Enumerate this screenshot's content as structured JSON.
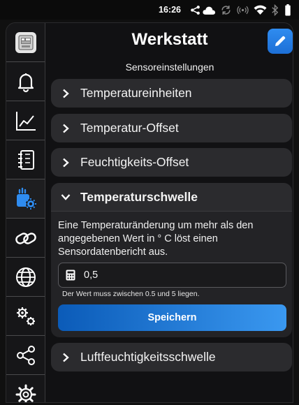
{
  "status_bar": {
    "time": "16:26",
    "icons": [
      "share-icon",
      "cloud-icon",
      "sync-icon",
      "hotspot-icon",
      "wifi-icon",
      "bluetooth-icon",
      "battery-icon"
    ]
  },
  "sidebar": {
    "items": [
      {
        "name": "device",
        "icon": "device-thumbnail-icon"
      },
      {
        "name": "notifications",
        "icon": "bell-icon"
      },
      {
        "name": "charts",
        "icon": "chart-line-icon"
      },
      {
        "name": "log",
        "icon": "log-list-icon"
      },
      {
        "name": "sensor-settings",
        "icon": "sensor-settings-icon",
        "active": true
      },
      {
        "name": "links",
        "icon": "link-icon"
      },
      {
        "name": "network",
        "icon": "globe-icon"
      },
      {
        "name": "advanced-settings",
        "icon": "gears-icon"
      },
      {
        "name": "share",
        "icon": "share-icon"
      },
      {
        "name": "settings",
        "icon": "gear-icon"
      }
    ],
    "accent": "#2f8cf0"
  },
  "header": {
    "title": "Werkstatt",
    "subtitle": "Sensoreinstellungen",
    "edit_icon": "pencil-icon"
  },
  "sections": [
    {
      "label": "Temperatureinheiten",
      "expanded": false
    },
    {
      "label": "Temperatur-Offset",
      "expanded": false
    },
    {
      "label": "Feuchtigkeits-Offset",
      "expanded": false
    },
    {
      "label": "Temperaturschwelle",
      "expanded": true
    },
    {
      "label": "Luftfeuchtigkeitsschwelle",
      "expanded": false
    }
  ],
  "threshold": {
    "description": "Eine Temperaturänderung um mehr als den angegebenen Wert in ° C löst einen Sensordatenbericht aus.",
    "value": "0,5",
    "field_icon": "calculator-icon",
    "hint": "Der Wert muss zwischen 0.5 und 5 liegen.",
    "save_label": "Speichern"
  },
  "colors": {
    "background": "#111113",
    "card": "#2b2b2e",
    "button_gradient_start": "#0b5bb8",
    "button_gradient_end": "#3a98f0"
  }
}
